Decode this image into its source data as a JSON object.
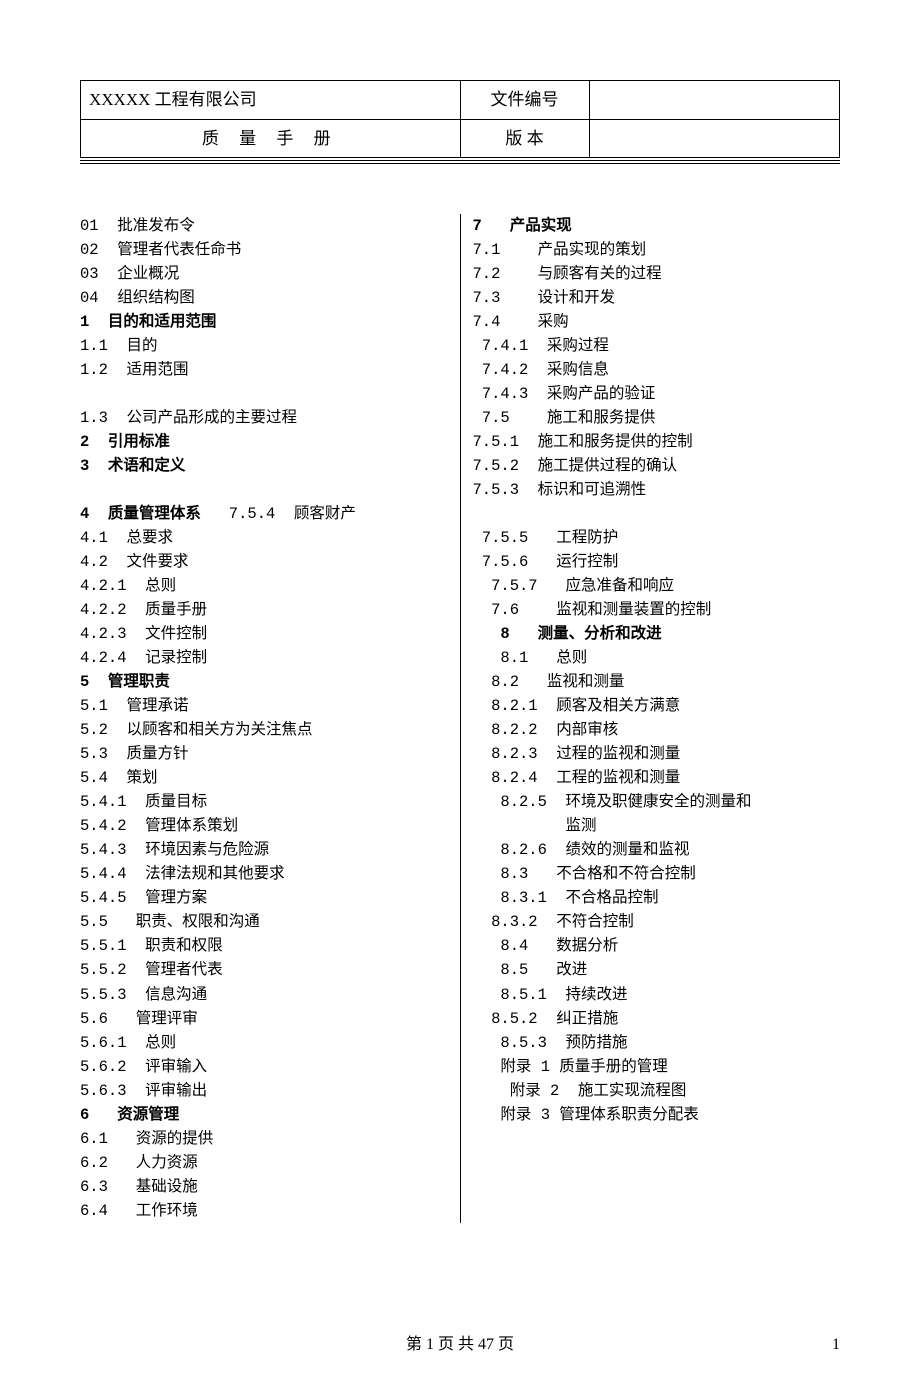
{
  "header": {
    "company": "XXXXX 工程有限公司",
    "title": "质 量 手 册",
    "doc_no_label": "文件编号",
    "doc_no_value": "",
    "version_label": "版 本",
    "version_value": ""
  },
  "toc": {
    "left": [
      {
        "t": "01  批准发布令"
      },
      {
        "t": "02  管理者代表任命书"
      },
      {
        "t": "03  企业概况"
      },
      {
        "t": "04  组织结构图"
      },
      {
        "t": "1  目的和适用范围",
        "b": true
      },
      {
        "t": "1.1  目的"
      },
      {
        "t": "1.2  适用范围"
      },
      {
        "t": ""
      },
      {
        "t": "1.3  公司产品形成的主要过程"
      },
      {
        "t": "2  引用标准",
        "b": true
      },
      {
        "t": "3  术语和定义",
        "b": true
      },
      {
        "t": ""
      },
      {
        "t": "4  质量管理体系",
        "b": true,
        "suffix": "   7.5.4  顾客财产"
      },
      {
        "t": "4.1  总要求"
      },
      {
        "t": "4.2  文件要求"
      },
      {
        "t": "4.2.1  总则"
      },
      {
        "t": "4.2.2  质量手册"
      },
      {
        "t": "4.2.3  文件控制"
      },
      {
        "t": "4.2.4  记录控制"
      },
      {
        "t": "5  管理职责",
        "b": true
      },
      {
        "t": "5.1  管理承诺"
      },
      {
        "t": "5.2  以顾客和相关方为关注焦点"
      },
      {
        "t": "5.3  质量方针"
      },
      {
        "t": "5.4  策划"
      },
      {
        "t": "5.4.1  质量目标"
      },
      {
        "t": "5.4.2  管理体系策划"
      },
      {
        "t": "5.4.3  环境因素与危险源"
      },
      {
        "t": "5.4.4  法律法规和其他要求"
      },
      {
        "t": "5.4.5  管理方案"
      },
      {
        "t": "5.5   职责、权限和沟通"
      },
      {
        "t": "5.5.1  职责和权限"
      },
      {
        "t": "5.5.2  管理者代表"
      },
      {
        "t": "5.5.3  信息沟通"
      },
      {
        "t": "5.6   管理评审"
      },
      {
        "t": "5.6.1  总则"
      },
      {
        "t": "5.6.2  评审输入"
      },
      {
        "t": "5.6.3  评审输出"
      },
      {
        "t": "6   资源管理",
        "b": true
      },
      {
        "t": "6.1   资源的提供"
      },
      {
        "t": "6.2   人力资源"
      },
      {
        "t": "6.3   基础设施"
      },
      {
        "t": "6.4   工作环境"
      }
    ],
    "right": [
      {
        "t": "7   产品实现",
        "b": true
      },
      {
        "t": "7.1    产品实现的策划"
      },
      {
        "t": "7.2    与顾客有关的过程"
      },
      {
        "t": "7.3    设计和开发"
      },
      {
        "t": "7.4    采购"
      },
      {
        "t": " 7.4.1  采购过程"
      },
      {
        "t": " 7.4.2  采购信息"
      },
      {
        "t": " 7.4.3  采购产品的验证"
      },
      {
        "t": " 7.5    施工和服务提供"
      },
      {
        "t": "7.5.1  施工和服务提供的控制"
      },
      {
        "t": "7.5.2  施工提供过程的确认"
      },
      {
        "t": "7.5.3  标识和可追溯性"
      },
      {
        "t": ""
      },
      {
        "t": " 7.5.5   工程防护"
      },
      {
        "t": " 7.5.6   运行控制"
      },
      {
        "t": "  7.5.7   应急准备和响应"
      },
      {
        "t": "  7.6    监视和测量装置的控制"
      },
      {
        "t": "   8   测量、分析和改进",
        "b": true
      },
      {
        "t": "   8.1   总则"
      },
      {
        "t": "  8.2   监视和测量"
      },
      {
        "t": "  8.2.1  顾客及相关方满意"
      },
      {
        "t": "  8.2.2  内部审核"
      },
      {
        "t": "  8.2.3  过程的监视和测量"
      },
      {
        "t": "  8.2.4  工程的监视和测量"
      },
      {
        "t": "   8.2.5  环境及职健康安全的测量和"
      },
      {
        "t": "          监测"
      },
      {
        "t": "   8.2.6  绩效的测量和监视"
      },
      {
        "t": "   8.3   不合格和不符合控制"
      },
      {
        "t": "   8.3.1  不合格品控制"
      },
      {
        "t": "  8.3.2  不符合控制"
      },
      {
        "t": "   8.4   数据分析"
      },
      {
        "t": "   8.5   改进"
      },
      {
        "t": "   8.5.1  持续改进"
      },
      {
        "t": "  8.5.2  纠正措施"
      },
      {
        "t": "   8.5.3  预防措施"
      },
      {
        "t": "   附录 1 质量手册的管理"
      },
      {
        "t": "    附录 2  施工实现流程图"
      },
      {
        "t": "   附录 3 管理体系职责分配表"
      }
    ]
  },
  "footer": {
    "center": "第 1 页 共 47 页",
    "right": "1"
  }
}
